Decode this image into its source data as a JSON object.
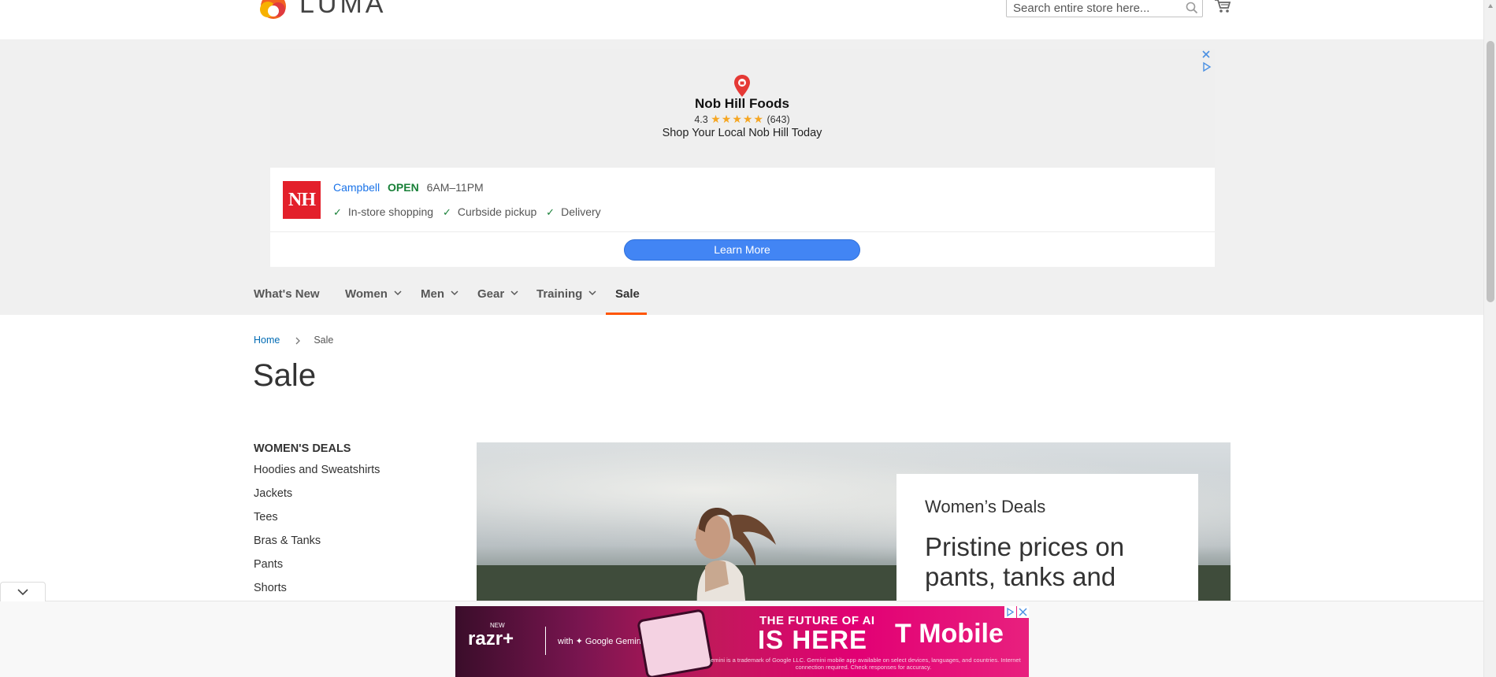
{
  "header": {
    "logo_text": "LUMA",
    "search_placeholder": "Search entire store here..."
  },
  "ad": {
    "store_name": "Nob Hill Foods",
    "rating": "4.3",
    "stars": "★★★★★",
    "review_count": "(643)",
    "tagline": "Shop Your Local Nob Hill Today",
    "logo_text": "NH",
    "location": "Campbell",
    "status": "OPEN",
    "hours": "6AM–11PM",
    "features": [
      "In-store shopping",
      "Curbside pickup",
      "Delivery"
    ],
    "cta": "Learn More",
    "colors": {
      "cta": "#4285f4",
      "open": "#188038",
      "location": "#1a73e8",
      "logo_bg": "#e3202b"
    }
  },
  "nav": {
    "items": [
      {
        "label": "What's New",
        "has_menu": false
      },
      {
        "label": "Women",
        "has_menu": true
      },
      {
        "label": "Men",
        "has_menu": true
      },
      {
        "label": "Gear",
        "has_menu": true
      },
      {
        "label": "Training",
        "has_menu": true
      },
      {
        "label": "Sale",
        "has_menu": false,
        "active": true
      }
    ],
    "active_color": "#ff5501"
  },
  "breadcrumb": {
    "home": "Home",
    "current": "Sale"
  },
  "page_title": "Sale",
  "sidebar": {
    "heading": "WOMEN'S DEALS",
    "links": [
      "Hoodies and Sweatshirts",
      "Jackets",
      "Tees",
      "Bras & Tanks",
      "Pants",
      "Shorts"
    ]
  },
  "hero": {
    "subtitle": "Women’s Deals",
    "headline": "Pristine prices on pants, tanks and"
  },
  "bottom_ad": {
    "brand_prefix": "NEW",
    "brand": "razr+",
    "partner": "with ✦ Google Gemini",
    "headline_1": "THE FUTURE OF AI",
    "headline_2": "IS HERE",
    "advertiser": "T Mobile",
    "fine_print": "Gemini is a trademark of Google LLC. Gemini mobile app available on select devices, languages, and countries. Internet connection required. Check responses for accuracy."
  }
}
